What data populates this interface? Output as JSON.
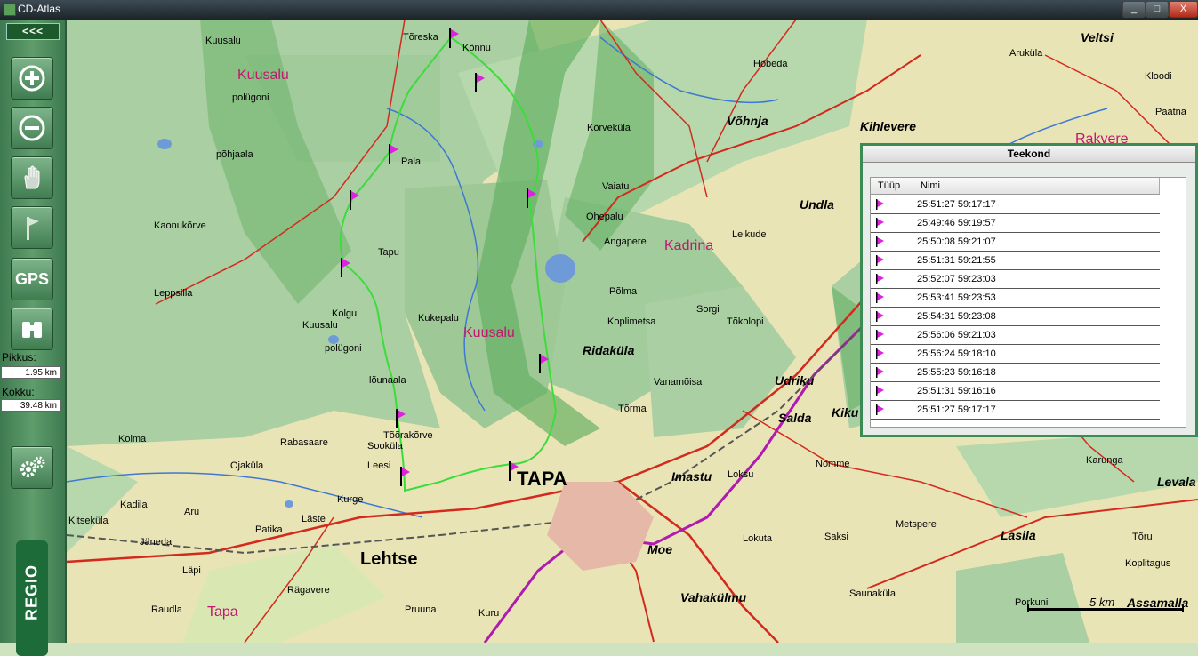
{
  "window": {
    "title": "CD-Atlas",
    "min": "_",
    "max": "□",
    "close": "X"
  },
  "sidebar": {
    "collapse_label": "<<<",
    "tools": [
      {
        "name": "zoom-in",
        "icon": "plus-circle-icon"
      },
      {
        "name": "zoom-out",
        "icon": "minus-circle-icon"
      },
      {
        "name": "pan",
        "icon": "hand-icon"
      },
      {
        "name": "flag",
        "icon": "flag-icon"
      },
      {
        "name": "gps",
        "label": "GPS"
      },
      {
        "name": "search",
        "icon": "binoculars-icon"
      }
    ],
    "pikkus_label": "Pikkus:",
    "pikkus_value": "1.95 km",
    "kokku_label": "Kokku:",
    "kokku_value": "39.48 km",
    "settings_icon": "gears-icon",
    "logo": "REGIO"
  },
  "panel": {
    "title": "Teekond",
    "columns": [
      "Tüüp",
      "Nimi"
    ],
    "rows": [
      "25:51:27  59:17:17",
      "25:49:46  59:19:57",
      "25:50:08  59:21:07",
      "25:51:31  59:21:55",
      "25:52:07  59:23:03",
      "25:53:41  59:23:53",
      "25:54:31  59:23:08",
      "25:56:06  59:21:03",
      "25:56:24  59:18:10",
      "25:55:23  59:16:18",
      "25:51:31  59:16:16",
      "25:51:27  59:17:17"
    ]
  },
  "map": {
    "scale_label": "5 km",
    "places": {
      "kuusalu_top": "Kuusalu",
      "poligoni_top": "polügoni",
      "pohjaala": "põhjaala",
      "toreska": "Tõreska",
      "konnu": "Kõnnu",
      "pala": "Pala",
      "kolgu": "Kolgu",
      "kuusalu2": "Kuusalu",
      "poligoni2": "polügoni",
      "louna": "lõunaala",
      "toorakorve": "Tõõrakõrve",
      "lehtse": "Lehtse",
      "tapa": "TAPA",
      "moe": "Moe",
      "imastu": "Imastu",
      "loksu": "Loksu",
      "vohnja": "Võhnja",
      "kihlevere": "Kihlevere",
      "rakvere": "Rakvere",
      "veltsi": "Veltsi",
      "hobeda": "Hõbeda",
      "korvekula": "Kõrveküla",
      "vaiatu": "Vaiatu",
      "ohepalu": "Ohepalu",
      "polma": "Põlma",
      "ridakula": "Ridaküla",
      "udriku": "Udriku",
      "salda": "Salda",
      "kiku": "Kiku",
      "leikude": "Leikude",
      "undla": "Undla",
      "kadrina_muni": "Kadrina",
      "kuusalu_muni2": "Kuusalu",
      "tapa_muni": "Tapa",
      "lasila": "Lasila",
      "assamalla": "Assamalla",
      "levala": "Levala",
      "karunga": "Karunga",
      "vahakulmu": "Vahakülmu",
      "kuru": "Kuru",
      "pruuna": "Pruuna",
      "ragavere": "Rägavere",
      "raudla": "Raudla",
      "lapi": "Läpi",
      "patika": "Patika",
      "laste": "Läste",
      "aru": "Aru",
      "kurge": "Kurge",
      "rabasaare": "Rabasaare",
      "kolma": "Kolma",
      "leppsilla": "Leppsilla",
      "kaonukorve": "Kaonukõrve",
      "lokuta": "Lokuta",
      "saksi": "Saksi",
      "sorgi": "Sorgi",
      "tokolopi": "Tõkolopi",
      "nomme": "Nõmme",
      "karunga2": "Karunga",
      "koplitagus": "Koplitagus",
      "taru": "Tõru",
      "porkuni": "Porkuni",
      "sauna": "Saunaküla",
      "metspere": "Metspere",
      "kadila": "Kadila",
      "janeda": "Jäneda",
      "kitsekula": "Kitseküla",
      "djakula": "Ojaküla",
      "leesi": "Leesi",
      "sookula": "Sooküla",
      "kukepalu": "Kukepalu",
      "tapu": "Tapu",
      "angapere": "Angapere",
      "koplimetsa": "Koplimetsa",
      "vanamoisa": "Vanamõisa",
      "torma": "Tõrma",
      "arukula": "Aruküla",
      "kloodi": "Kloodi",
      "paatna": "Paatna"
    }
  }
}
